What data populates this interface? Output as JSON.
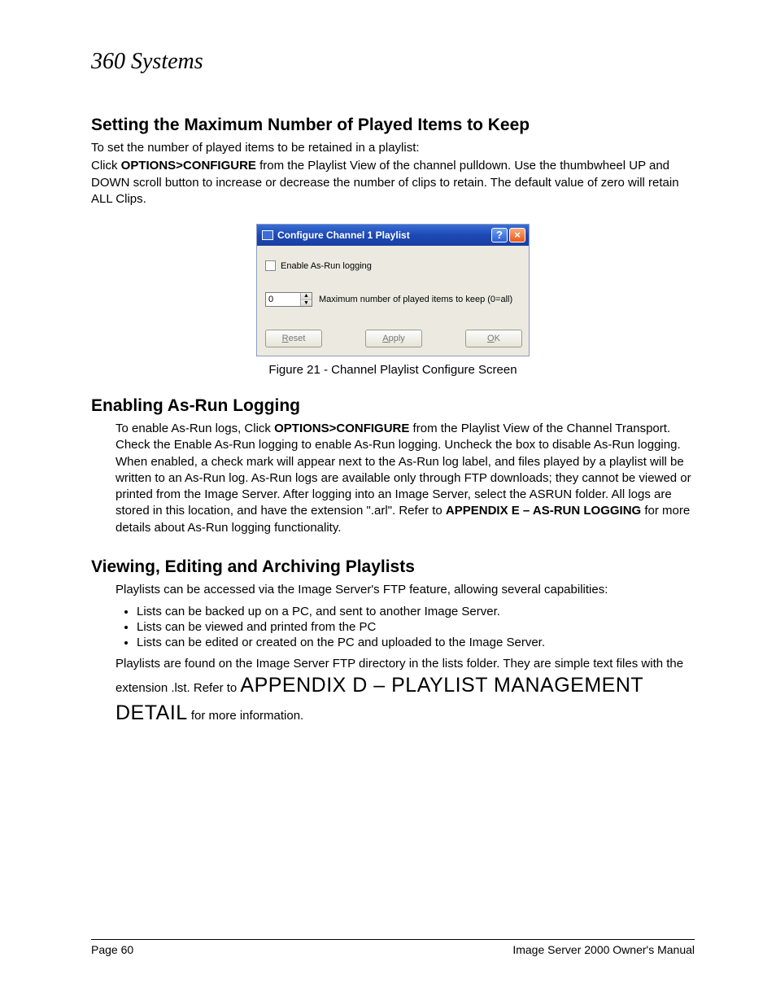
{
  "logo_text": "360 Systems",
  "section1": {
    "heading": "Setting the Maximum Number of Played Items to Keep",
    "intro": "To set the number of played items to be retained in a playlist:",
    "click_text": "Click ",
    "options_configure": "OPTIONS>CONFIGURE",
    "rest": " from the Playlist View of the channel pulldown. Use the thumbwheel UP and DOWN scroll button to increase or decrease the number of clips to retain. The default value of zero will retain ALL Clips."
  },
  "dialog": {
    "title": "Configure Channel 1 Playlist",
    "checkbox_label": "Enable As-Run logging",
    "spinner_value": "0",
    "spinner_label": "Maximum number of played items to keep (0=all)",
    "btn_reset": "Reset",
    "btn_reset_ul": "R",
    "btn_apply": "Apply",
    "btn_apply_ul": "A",
    "btn_ok": "OK",
    "btn_ok_ul": "O"
  },
  "figure_caption": "Figure 21 - Channel Playlist Configure Screen",
  "section2": {
    "heading": "Enabling As-Run Logging",
    "p1a": "To enable As-Run logs, Click ",
    "p1b": "OPTIONS>CONFIGURE",
    "p1c": " from the Playlist View of the Channel Transport. Check the Enable As-Run logging to enable As-Run logging. Uncheck the box to disable As-Run logging.  When enabled, a check mark will appear next to the As-Run log label, and files played by a playlist will be written to an As-Run log. As-Run logs are available only through FTP downloads; they cannot be viewed or printed from the Image Server.  After logging into an Image Server, select the ASRUN folder.  All logs are stored in this location, and have the extension \".arl\". Refer to ",
    "p1d": "APPENDIX E – AS-RUN LOGGING",
    "p1e": " for more details about As-Run logging functionality."
  },
  "section3": {
    "heading": "Viewing, Editing and Archiving Playlists",
    "intro": "Playlists can be accessed via the Image Server's FTP feature, allowing several capabilities:",
    "bullets": [
      "Lists can be backed up on a PC, and sent to another Image Server.",
      "Lists can be viewed and printed from the PC",
      "Lists can be edited or created on the PC and uploaded to the Image Server."
    ],
    "p2a": "Playlists are found on the Image Server FTP directory in the lists folder.  They are simple text files with the extension .lst. Refer to ",
    "p2b": "APPENDIX D – PLAYLIST MANAGEMENT DETAIL",
    "p2c": " for more information."
  },
  "footer": {
    "left": "Page 60",
    "right": "Image Server 2000 Owner's Manual"
  }
}
